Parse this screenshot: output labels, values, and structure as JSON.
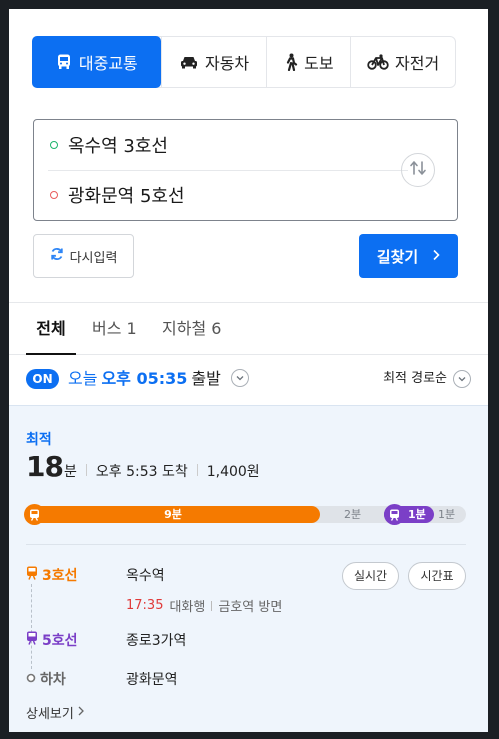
{
  "modes": [
    {
      "label": "대중교통",
      "icon": "bus-icon",
      "active": true
    },
    {
      "label": "자동차",
      "icon": "car-icon",
      "active": false
    },
    {
      "label": "도보",
      "icon": "walk-icon",
      "active": false
    },
    {
      "label": "자전거",
      "icon": "bicycle-icon",
      "active": false
    }
  ],
  "route": {
    "from": "옥수역 3호선",
    "to": "광화문역 5호선"
  },
  "actions": {
    "reset_label": "다시입력",
    "search_label": "길찾기"
  },
  "tabs": [
    {
      "label": "전체",
      "active": true
    },
    {
      "label": "버스 1",
      "active": false
    },
    {
      "label": "지하철 6",
      "active": false
    }
  ],
  "departure": {
    "badge": "ON",
    "day": "오늘",
    "time": "오후 05:35",
    "suffix": "출발",
    "sort_label": "최적 경로순"
  },
  "result": {
    "tag": "최적",
    "duration_value": "18",
    "duration_unit": "분",
    "arrival": "오후 5:53 도착",
    "fare": "1,400원",
    "segments": {
      "line3_ride": "9분",
      "transfer_walk": "2분",
      "line5_ride": "1분",
      "final_walk": "1분"
    },
    "steps": [
      {
        "line": "3호선",
        "station": "옥수역",
        "color": "#f57a00"
      },
      {
        "line": "5호선",
        "station": "종로3가역",
        "color": "#7b3fc7"
      },
      {
        "line": "하차",
        "station": "광화문역",
        "color": "#666666"
      }
    ],
    "departure_info": {
      "time": "17:35",
      "direction": "대화행",
      "platform": "금호역 방면"
    },
    "buttons": {
      "realtime": "실시간",
      "timetable": "시간표"
    },
    "detail_link": "상세보기"
  },
  "colors": {
    "accent": "#0c6ff2",
    "line3": "#f57a00",
    "line5": "#7b3fc7"
  }
}
